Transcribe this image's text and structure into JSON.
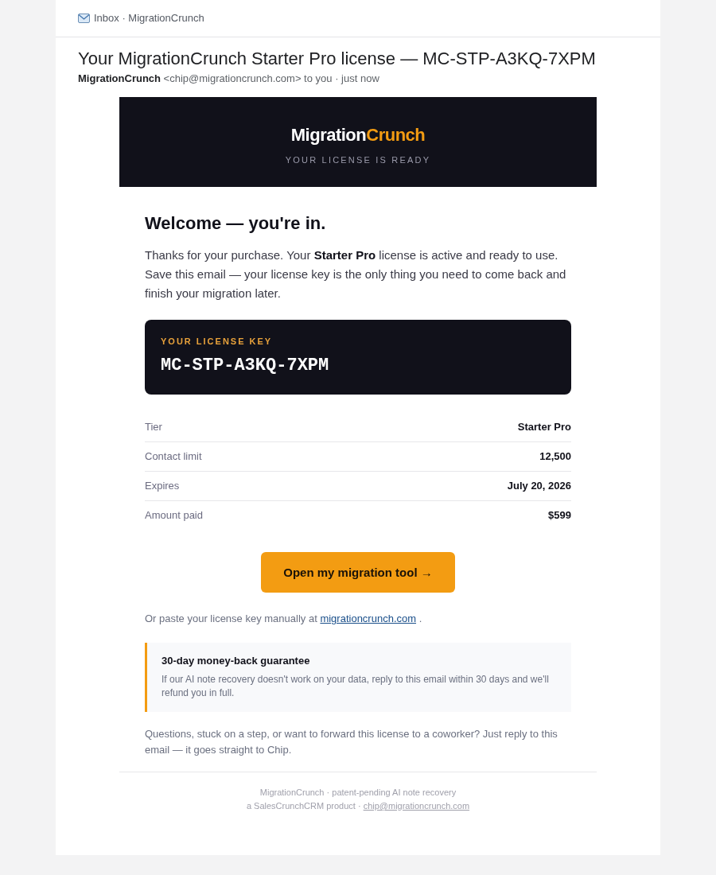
{
  "viewer": {
    "breadcrumb": "Inbox · MigrationCrunch"
  },
  "message": {
    "subject": "Your MigrationCrunch Starter Pro license — MC-STP-A3KQ-7XPM",
    "from_line": "**MigrationCrunch** <chip@migrationcrunch.com> to you · just now"
  },
  "banner": {
    "logo": {
      "primary": "Migration",
      "accent": "Crunch"
    },
    "tagline": "YOUR LICENSE IS READY"
  },
  "welcome": {
    "heading": "Welcome — you're in.",
    "text": "Thanks for your purchase. Your **Starter Pro** license is active and ready to use. Save this email — your license key is the only thing you need to come back and finish your migration later."
  },
  "license_key": {
    "label": "YOUR LICENSE KEY",
    "key": "MC-STP-A3KQ-7XPM"
  },
  "details": [
    {
      "label": "Tier",
      "value": "Starter Pro"
    },
    {
      "label": "Contact limit",
      "value": "12,500"
    },
    {
      "label": "Expires",
      "value": "July 20, 2026"
    },
    {
      "label": "Amount paid",
      "value": "$599"
    }
  ],
  "cta": {
    "label": "Open my migration tool →"
  },
  "manual": {
    "before": "Or paste your license key manually at ",
    "link": "migrationcrunch.com",
    "after": " ."
  },
  "guarantee": {
    "title": "30-day money-back guarantee",
    "body": "If our AI note recovery doesn't work on your data, reply to this email within 30 days and we'll refund you in full."
  },
  "closing": "Questions, stuck on a step, or want to forward this license to a coworker? Just reply to this email — it goes straight to Chip.",
  "footer": {
    "line_1": "MigrationCrunch · patent-pending AI note recovery",
    "line_2_prefix": "a SalesCrunchCRM product · ",
    "email": "chip@migrationcrunch.com"
  }
}
